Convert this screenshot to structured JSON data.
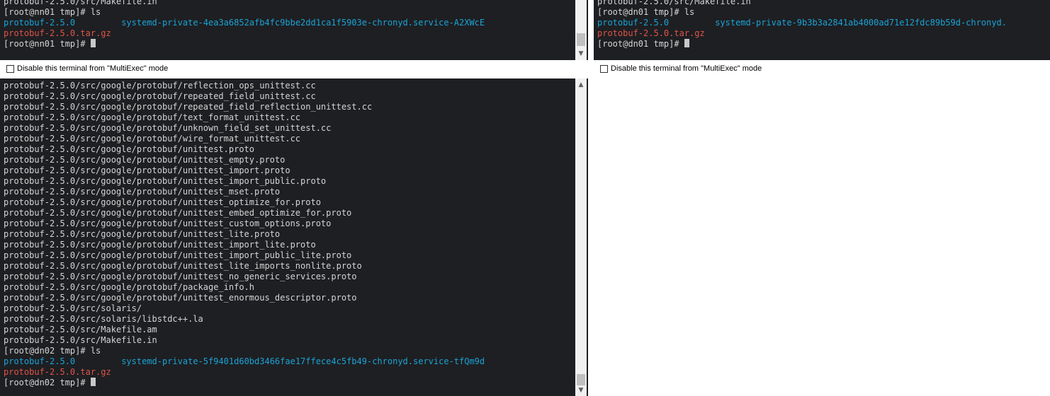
{
  "pane_nn01": {
    "lines": [
      {
        "segments": [
          {
            "text": "protobuf-2.5.0/src/Makefile.in",
            "style": "normal"
          }
        ]
      },
      {
        "segments": [
          {
            "text": "[root@nn01 tmp]# ls",
            "style": "normal"
          }
        ]
      },
      {
        "segments": [
          {
            "text": "protobuf-2.5.0",
            "style": "dir"
          },
          {
            "text": "         ",
            "style": "normal"
          },
          {
            "text": "systemd-private-4ea3a6852afb4fc9bbe2dd1ca1f5903e-chronyd.service-A2XWcE",
            "style": "dir"
          }
        ]
      },
      {
        "segments": [
          {
            "text": "protobuf-2.5.0.tar.gz",
            "style": "archive"
          }
        ]
      }
    ],
    "prompt": "[root@nn01 tmp]# "
  },
  "pane_dn01": {
    "lines": [
      {
        "segments": [
          {
            "text": "protobuf-2.5.0/src/Makefile.in",
            "style": "normal"
          }
        ]
      },
      {
        "segments": [
          {
            "text": "[root@dn01 tmp]# ls",
            "style": "normal"
          }
        ]
      },
      {
        "segments": [
          {
            "text": "protobuf-2.5.0",
            "style": "dir"
          },
          {
            "text": "         ",
            "style": "normal"
          },
          {
            "text": "systemd-private-9b3b3a2841ab4000ad71e12fdc89b59d-chronyd.",
            "style": "dir"
          }
        ]
      },
      {
        "segments": [
          {
            "text": "protobuf-2.5.0.tar.gz",
            "style": "archive"
          }
        ]
      }
    ],
    "prompt": "[root@dn01 tmp]# "
  },
  "pane_dn02": {
    "lines": [
      {
        "segments": [
          {
            "text": "protobuf-2.5.0/src/google/protobuf/reflection_ops_unittest.cc",
            "style": "normal"
          }
        ]
      },
      {
        "segments": [
          {
            "text": "protobuf-2.5.0/src/google/protobuf/repeated_field_unittest.cc",
            "style": "normal"
          }
        ]
      },
      {
        "segments": [
          {
            "text": "protobuf-2.5.0/src/google/protobuf/repeated_field_reflection_unittest.cc",
            "style": "normal"
          }
        ]
      },
      {
        "segments": [
          {
            "text": "protobuf-2.5.0/src/google/protobuf/text_format_unittest.cc",
            "style": "normal"
          }
        ]
      },
      {
        "segments": [
          {
            "text": "protobuf-2.5.0/src/google/protobuf/unknown_field_set_unittest.cc",
            "style": "normal"
          }
        ]
      },
      {
        "segments": [
          {
            "text": "protobuf-2.5.0/src/google/protobuf/wire_format_unittest.cc",
            "style": "normal"
          }
        ]
      },
      {
        "segments": [
          {
            "text": "protobuf-2.5.0/src/google/protobuf/unittest.proto",
            "style": "normal"
          }
        ]
      },
      {
        "segments": [
          {
            "text": "protobuf-2.5.0/src/google/protobuf/unittest_empty.proto",
            "style": "normal"
          }
        ]
      },
      {
        "segments": [
          {
            "text": "protobuf-2.5.0/src/google/protobuf/unittest_import.proto",
            "style": "normal"
          }
        ]
      },
      {
        "segments": [
          {
            "text": "protobuf-2.5.0/src/google/protobuf/unittest_import_public.proto",
            "style": "normal"
          }
        ]
      },
      {
        "segments": [
          {
            "text": "protobuf-2.5.0/src/google/protobuf/unittest_mset.proto",
            "style": "normal"
          }
        ]
      },
      {
        "segments": [
          {
            "text": "protobuf-2.5.0/src/google/protobuf/unittest_optimize_for.proto",
            "style": "normal"
          }
        ]
      },
      {
        "segments": [
          {
            "text": "protobuf-2.5.0/src/google/protobuf/unittest_embed_optimize_for.proto",
            "style": "normal"
          }
        ]
      },
      {
        "segments": [
          {
            "text": "protobuf-2.5.0/src/google/protobuf/unittest_custom_options.proto",
            "style": "normal"
          }
        ]
      },
      {
        "segments": [
          {
            "text": "protobuf-2.5.0/src/google/protobuf/unittest_lite.proto",
            "style": "normal"
          }
        ]
      },
      {
        "segments": [
          {
            "text": "protobuf-2.5.0/src/google/protobuf/unittest_import_lite.proto",
            "style": "normal"
          }
        ]
      },
      {
        "segments": [
          {
            "text": "protobuf-2.5.0/src/google/protobuf/unittest_import_public_lite.proto",
            "style": "normal"
          }
        ]
      },
      {
        "segments": [
          {
            "text": "protobuf-2.5.0/src/google/protobuf/unittest_lite_imports_nonlite.proto",
            "style": "normal"
          }
        ]
      },
      {
        "segments": [
          {
            "text": "protobuf-2.5.0/src/google/protobuf/unittest_no_generic_services.proto",
            "style": "normal"
          }
        ]
      },
      {
        "segments": [
          {
            "text": "protobuf-2.5.0/src/google/protobuf/package_info.h",
            "style": "normal"
          }
        ]
      },
      {
        "segments": [
          {
            "text": "protobuf-2.5.0/src/google/protobuf/unittest_enormous_descriptor.proto",
            "style": "normal"
          }
        ]
      },
      {
        "segments": [
          {
            "text": "protobuf-2.5.0/src/solaris/",
            "style": "normal"
          }
        ]
      },
      {
        "segments": [
          {
            "text": "protobuf-2.5.0/src/solaris/libstdc++.la",
            "style": "normal"
          }
        ]
      },
      {
        "segments": [
          {
            "text": "protobuf-2.5.0/src/Makefile.am",
            "style": "normal"
          }
        ]
      },
      {
        "segments": [
          {
            "text": "protobuf-2.5.0/src/Makefile.in",
            "style": "normal"
          }
        ]
      },
      {
        "segments": [
          {
            "text": "[root@dn02 tmp]# ls",
            "style": "normal"
          }
        ]
      },
      {
        "segments": [
          {
            "text": "protobuf-2.5.0",
            "style": "dir"
          },
          {
            "text": "         ",
            "style": "normal"
          },
          {
            "text": "systemd-private-5f9401d60bd3466fae17ffece4c5fb49-chronyd.service-tfQm9d",
            "style": "dir"
          }
        ]
      },
      {
        "segments": [
          {
            "text": "protobuf-2.5.0.tar.gz",
            "style": "archive"
          }
        ]
      }
    ],
    "prompt": "[root@dn02 tmp]# "
  },
  "multiexec": {
    "label": "Disable this terminal from \"MultiExec\" mode",
    "checked": false
  },
  "colors": {
    "terminal_bg": "#1e1f22",
    "text": "#d4d4d4",
    "directory": "#1aa3d6",
    "archive": "#e0534a"
  },
  "icons": {
    "scroll_up": "chevron-up-icon",
    "scroll_down": "chevron-down-icon"
  }
}
